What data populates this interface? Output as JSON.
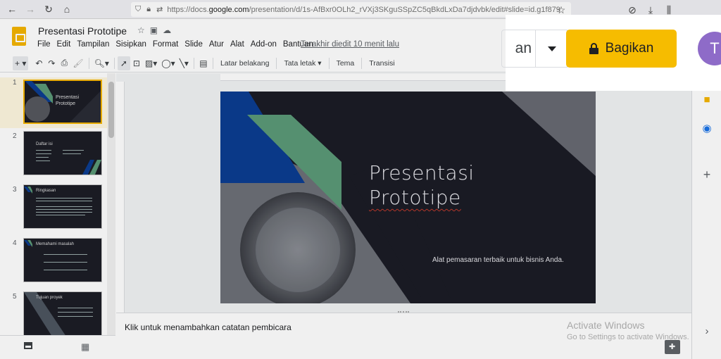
{
  "browser": {
    "url_prefix": "https://docs.",
    "url_domain": "google.com",
    "url_rest": "/presentation/d/1s-AfBxr0OLh2_rVXj3SKguSSpZC5qBkdLxDa7djdvbk/edit#slide=id.g1f879"
  },
  "doc": {
    "title": "Presentasi Prototipe",
    "last_edit": "Terakhir diedit 10 menit lalu"
  },
  "menu": [
    "File",
    "Edit",
    "Tampilan",
    "Sisipkan",
    "Format",
    "Slide",
    "Atur",
    "Alat",
    "Add-on",
    "Bantuan"
  ],
  "share": {
    "present_label": "an",
    "share_label": "Bagikan",
    "avatar_letter": "T"
  },
  "toolbar": {
    "background": "Latar belakang",
    "layout": "Tata letak",
    "theme": "Tema",
    "transition": "Transisi"
  },
  "slides": [
    {
      "num": "1",
      "title": "Presentasi Prototipe"
    },
    {
      "num": "2",
      "title": "Daftar isi"
    },
    {
      "num": "3",
      "title": "Ringkasan"
    },
    {
      "num": "4",
      "title": "Memahami masalah"
    },
    {
      "num": "5",
      "title": "Tujuan proyek"
    }
  ],
  "main_slide": {
    "title_line1": "Presentasi",
    "title_line2": "Prototipe",
    "subtitle": "Alat pemasaran terbaik untuk bisnis Anda."
  },
  "notes": {
    "placeholder": "Klik untuk menambahkan catatan pembicara"
  },
  "watermark": {
    "line1": "Activate Windows",
    "line2": "Go to Settings to activate Windows."
  },
  "colors": {
    "share_yellow": "#f6bc00",
    "avatar_purple": "#8e6bc8",
    "slide_bg": "#1b1c26",
    "accent_green": "#5b9a78",
    "accent_blue": "#0b3d91"
  }
}
